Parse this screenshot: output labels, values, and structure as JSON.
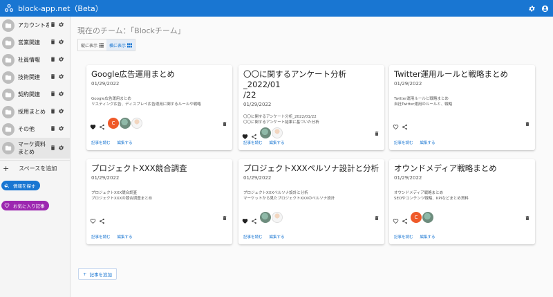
{
  "app": {
    "title": "block-app.net（Beta）"
  },
  "sidebar": {
    "items": [
      {
        "label": "アカウント系"
      },
      {
        "label": "営業関連"
      },
      {
        "label": "社員情報"
      },
      {
        "label": "技術関連"
      },
      {
        "label": "契約関連"
      },
      {
        "label": "採用まとめ"
      },
      {
        "label": "その他"
      },
      {
        "label": "マーケ資料まとめ"
      }
    ],
    "add_space_label": "スペースを追加",
    "search_label": "情報を探す",
    "favorites_label": "お気に入り記事"
  },
  "main": {
    "team_title": "現在のチーム：「Blockチーム」",
    "view_vertical": "縦に表示",
    "view_horizontal": "横に表示",
    "add_article_label": "記事を追加"
  },
  "card_labels": {
    "read": "記事を読む",
    "edit": "編集する"
  },
  "cards": [
    {
      "title": "Google広告運用まとめ",
      "date": "01/29/2022",
      "desc1": "Google広告運用まとめ",
      "desc2": "リスティング広告、ディスプレイ広告運用に関するルールや戦略",
      "liked": true,
      "avatar_letter": "C"
    },
    {
      "title": "〇〇に関するアンケート分析_2022/01/22",
      "title_line1": "〇〇に関するアンケート分析_2022/01",
      "title_line2": "/22",
      "date": "01/29/2022",
      "desc1": "〇〇に関するアンケート分析_2022/01/22",
      "desc2": "〇〇に関するアンケート結果に基づいた分析",
      "liked": true
    },
    {
      "title": "Twitter運用ルールと戦略まとめ",
      "date": "01/29/2022",
      "desc1": "Twitter運用ルールと戦略まとめ",
      "desc2": "自社Twitter運用のルールと、戦略",
      "liked": false
    },
    {
      "title": "プロジェクトXXX競合調査",
      "date": "01/29/2022",
      "desc1": "プロジェクトXXX競合調査",
      "desc2": "プロジェクトXXXの競合調査まとめ",
      "liked": false
    },
    {
      "title": "プロジェクトXXXペルソナ設計と分析",
      "date": "01/29/2022",
      "desc1": "プロジェクトXXXペルソナ設計と分析",
      "desc2": "マーケットから見たプロジェクトXXXのペルソナ設計",
      "liked": true
    },
    {
      "title": "オウンドメディア戦略まとめ",
      "date": "01/29/2022",
      "desc1": "オウンドメディア戦略まとめ",
      "desc2": "SEOやコンテンツ戦略、KPIなどまとめ資料",
      "liked": false,
      "avatar_letter": "C"
    }
  ],
  "colors": {
    "primary": "#1976d2",
    "purple": "#9c27b0",
    "avatar_orange": "#ef5a2a"
  }
}
